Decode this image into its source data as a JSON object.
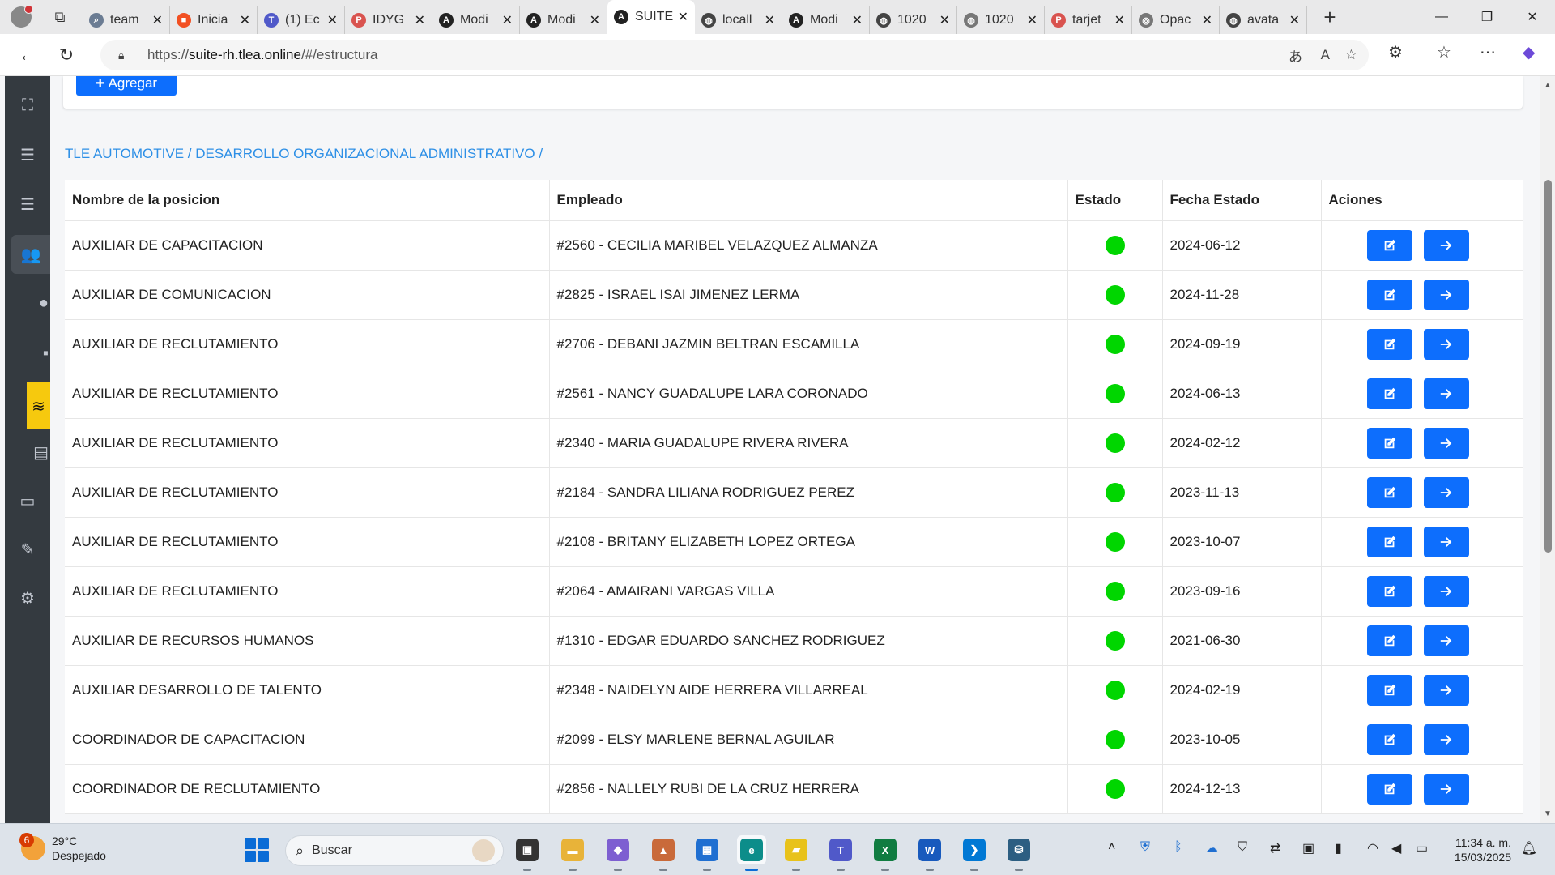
{
  "browser": {
    "tabs": [
      {
        "label": "team",
        "icon": "search-icon",
        "color": "#6b7c93",
        "glyph": "⌕"
      },
      {
        "label": "Inicia",
        "icon": "microsoft-icon",
        "color": "#f25022",
        "glyph": "■"
      },
      {
        "label": "(1) Ec",
        "icon": "teams-icon",
        "color": "#5059c9",
        "glyph": "T"
      },
      {
        "label": "IDYG",
        "icon": "pdf-icon",
        "color": "#d9534f",
        "glyph": "P"
      },
      {
        "label": "Modi",
        "icon": "angular-icon",
        "color": "#222222",
        "glyph": "A"
      },
      {
        "label": "Modi",
        "icon": "angular-icon",
        "color": "#222222",
        "glyph": "A"
      },
      {
        "label": "SUITE",
        "icon": "angular-icon",
        "color": "#222222",
        "glyph": "A",
        "active": true
      },
      {
        "label": "locall",
        "icon": "globe-icon",
        "color": "#444444",
        "glyph": "◍"
      },
      {
        "label": "Modi",
        "icon": "angular-icon",
        "color": "#222222",
        "glyph": "A"
      },
      {
        "label": "1020",
        "icon": "globe-icon",
        "color": "#444444",
        "glyph": "◍"
      },
      {
        "label": "1020",
        "icon": "globe-icon",
        "color": "#777777",
        "glyph": "◍"
      },
      {
        "label": "tarjet",
        "icon": "pdf-icon",
        "color": "#d9534f",
        "glyph": "P"
      },
      {
        "label": "Opac",
        "icon": "openai-icon",
        "color": "#777777",
        "glyph": "◎"
      },
      {
        "label": "avata",
        "icon": "globe-icon",
        "color": "#444444",
        "glyph": "◍"
      }
    ],
    "url_prefix": "https://",
    "url_host": "suite-rh.tlea.online",
    "url_path": "/#/estructura"
  },
  "page": {
    "add_button": "Agregar",
    "breadcrumb": "TLE AUTOMOTIVE / DESARROLLO ORGANIZACIONAL ADMINISTRATIVO /",
    "columns": {
      "position": "Nombre de la posicion",
      "employee": "Empleado",
      "status": "Estado",
      "status_date": "Fecha Estado",
      "actions": "Aciones"
    },
    "status_color": "#00d600",
    "rows": [
      {
        "position": "AUXILIAR DE CAPACITACION",
        "employee": "#2560 - CECILIA MARIBEL VELAZQUEZ ALMANZA",
        "date": "2024-06-12"
      },
      {
        "position": "AUXILIAR DE COMUNICACION",
        "employee": "#2825 - ISRAEL ISAI JIMENEZ LERMA",
        "date": "2024-11-28"
      },
      {
        "position": "AUXILIAR DE RECLUTAMIENTO",
        "employee": "#2706 - DEBANI JAZMIN BELTRAN ESCAMILLA",
        "date": "2024-09-19"
      },
      {
        "position": "AUXILIAR DE RECLUTAMIENTO",
        "employee": "#2561 - NANCY GUADALUPE LARA CORONADO",
        "date": "2024-06-13"
      },
      {
        "position": "AUXILIAR DE RECLUTAMIENTO",
        "employee": "#2340 - MARIA GUADALUPE RIVERA RIVERA",
        "date": "2024-02-12"
      },
      {
        "position": "AUXILIAR DE RECLUTAMIENTO",
        "employee": "#2184 - SANDRA LILIANA RODRIGUEZ PEREZ",
        "date": "2023-11-13"
      },
      {
        "position": "AUXILIAR DE RECLUTAMIENTO",
        "employee": "#2108 - BRITANY ELIZABETH LOPEZ ORTEGA",
        "date": "2023-10-07"
      },
      {
        "position": "AUXILIAR DE RECLUTAMIENTO",
        "employee": "#2064 - AMAIRANI VARGAS VILLA",
        "date": "2023-09-16"
      },
      {
        "position": "AUXILIAR DE RECURSOS HUMANOS",
        "employee": "#1310 - EDGAR EDUARDO SANCHEZ RODRIGUEZ",
        "date": "2021-06-30"
      },
      {
        "position": "AUXILIAR DESARROLLO DE TALENTO",
        "employee": "#2348 - NAIDELYN AIDE HERRERA VILLARREAL",
        "date": "2024-02-19"
      },
      {
        "position": "COORDINADOR DE CAPACITACION",
        "employee": "#2099 - ELSY MARLENE BERNAL AGUILAR",
        "date": "2023-10-05"
      },
      {
        "position": "COORDINADOR DE RECLUTAMIENTO",
        "employee": "#2856 - NALLELY RUBI DE LA CRUZ HERRERA",
        "date": "2024-12-13"
      }
    ]
  },
  "sidebar": [
    {
      "icon": "org-chart-icon",
      "glyph": "⛶"
    },
    {
      "icon": "task-list-icon",
      "glyph": "☰"
    },
    {
      "icon": "checklist-icon",
      "glyph": "☰"
    },
    {
      "icon": "users-icon",
      "glyph": "👥",
      "active": true
    },
    {
      "icon": "user-group-icon",
      "glyph": "●",
      "partial": true
    },
    {
      "icon": "id-badge-icon",
      "glyph": "▪",
      "partial": true
    },
    {
      "icon": "brand-logo-icon",
      "glyph": "≋",
      "yellow": true
    },
    {
      "icon": "document-icon",
      "glyph": "▤",
      "partial": true
    },
    {
      "icon": "id-card-icon",
      "glyph": "▭"
    },
    {
      "icon": "signature-icon",
      "glyph": "✎"
    },
    {
      "icon": "team-settings-icon",
      "glyph": "⚙"
    }
  ],
  "taskbar": {
    "weather_temp": "29°C",
    "weather_desc": "Despejado",
    "weather_badge": "6",
    "search_placeholder": "Buscar",
    "time": "11:34 a. m.",
    "date": "15/03/2025",
    "apps": [
      {
        "name": "task-view-icon",
        "color": "#333333",
        "glyph": "▣"
      },
      {
        "name": "file-explorer-icon",
        "color": "#e8b339",
        "glyph": "▬"
      },
      {
        "name": "m365-icon",
        "color": "#7d5fd1",
        "glyph": "◆"
      },
      {
        "name": "photos-icon",
        "color": "#c96a3a",
        "glyph": "▲"
      },
      {
        "name": "store-icon",
        "color": "#1f6fd1",
        "glyph": "▦"
      },
      {
        "name": "edge-icon",
        "color": "#0c8d8a",
        "glyph": "e",
        "active": true
      },
      {
        "name": "sticky-notes-icon",
        "color": "#e8c21a",
        "glyph": "▰"
      },
      {
        "name": "teams-icon",
        "color": "#5059c9",
        "glyph": "T"
      },
      {
        "name": "excel-icon",
        "color": "#107c41",
        "glyph": "X"
      },
      {
        "name": "word-icon",
        "color": "#185abd",
        "glyph": "W"
      },
      {
        "name": "vscode-icon",
        "color": "#0078d4",
        "glyph": "❯"
      },
      {
        "name": "mysql-workbench-icon",
        "color": "#2c5e82",
        "glyph": "⛁"
      }
    ]
  }
}
